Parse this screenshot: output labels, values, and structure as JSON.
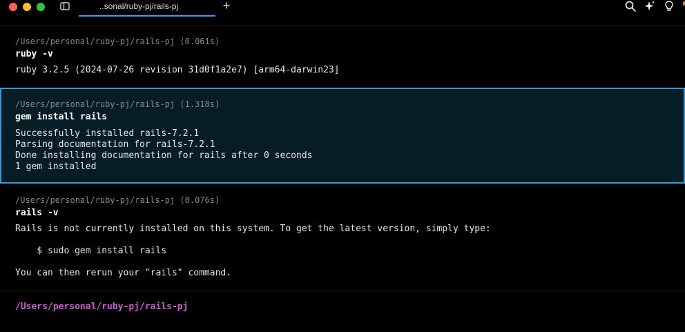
{
  "window": {
    "tab_title": "..sonal/ruby-pj/rails-pj",
    "new_tab_symbol": "+"
  },
  "blocks": [
    {
      "path": "/Users/personal/ruby-pj/rails-pj (0.061s)",
      "command": "ruby -v",
      "output": [
        "ruby 3.2.5 (2024-07-26 revision 31d0f1a2e7) [arm64-darwin23]"
      ]
    },
    {
      "path": "/Users/personal/ruby-pj/rails-pj (1.318s)",
      "command": "gem install rails",
      "output": [
        "Successfully installed rails-7.2.1",
        "Parsing documentation for rails-7.2.1",
        "Done installing documentation for rails after 0 seconds",
        "1 gem installed"
      ]
    },
    {
      "path": "/Users/personal/ruby-pj/rails-pj (0.076s)",
      "command": "rails -v",
      "output": [
        "Rails is not currently installed on this system. To get the latest version, simply type:",
        "    $ sudo gem install rails",
        "You can then rerun your \"rails\" command."
      ]
    }
  ],
  "prompt": "/Users/personal/ruby-pj/rails-pj",
  "colors": {
    "selected_block_bg": "#061d26",
    "selected_block_border": "#3b9ad9",
    "prompt_color": "#d25ad6"
  }
}
